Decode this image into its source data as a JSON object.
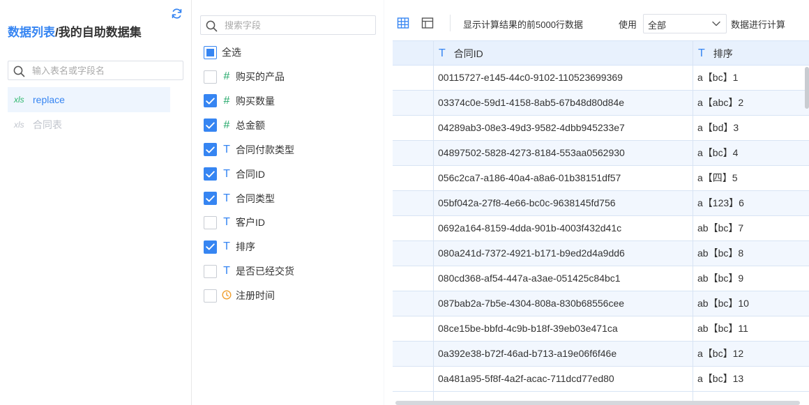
{
  "left": {
    "crumb_link": "数据列表",
    "crumb_sep": "/",
    "crumb_current": "我的自助数据集",
    "search_placeholder": "输入表名或字段名",
    "tables": [
      {
        "icon": "xls",
        "name": "replace",
        "state": "active"
      },
      {
        "icon": "xls",
        "name": "合同表",
        "state": "disabled"
      }
    ]
  },
  "middle": {
    "search_placeholder": "搜索字段",
    "select_all": {
      "label": "全选",
      "state": "partial"
    },
    "fields": [
      {
        "type": "#",
        "type_icon": "number-icon",
        "name": "购买的产品",
        "checked": false
      },
      {
        "type": "#",
        "type_icon": "number-icon",
        "name": "购买数量",
        "checked": true
      },
      {
        "type": "#",
        "type_icon": "number-icon",
        "name": "总金额",
        "checked": true
      },
      {
        "type": "T",
        "type_icon": "text-type-icon",
        "name": "合同付款类型",
        "checked": true
      },
      {
        "type": "T",
        "type_icon": "text-type-icon",
        "name": "合同ID",
        "checked": true
      },
      {
        "type": "T",
        "type_icon": "text-type-icon",
        "name": "合同类型",
        "checked": true
      },
      {
        "type": "T",
        "type_icon": "text-type-icon",
        "name": "客户ID",
        "checked": false
      },
      {
        "type": "T",
        "type_icon": "text-type-icon",
        "name": "排序",
        "checked": true
      },
      {
        "type": "T",
        "type_icon": "text-type-icon",
        "name": "是否已经交货",
        "checked": false
      },
      {
        "type": "clock",
        "type_icon": "clock-icon",
        "name": "注册时间",
        "checked": false
      }
    ]
  },
  "toolbar": {
    "desc": "显示计算结果的前5000行数据",
    "use_label": "使用",
    "select_value": "全部",
    "after_label": "数据进行计算"
  },
  "grid": {
    "columns": [
      {
        "type": "T",
        "label": "合同ID"
      },
      {
        "type": "T",
        "label": "排序"
      }
    ],
    "rows": [
      [
        "00115727-e145-44c0-9102-110523699369",
        "a【bc】1"
      ],
      [
        "03374c0e-59d1-4158-8ab5-67b48d80d84e",
        "a【abc】2"
      ],
      [
        "04289ab3-08e3-49d3-9582-4dbb945233e7",
        "a【bd】3"
      ],
      [
        "04897502-5828-4273-8184-553aa0562930",
        "a【bc】4"
      ],
      [
        "056c2ca7-a186-40a4-a8a6-01b38151df57",
        "a【四】5"
      ],
      [
        "05bf042a-27f8-4e66-bc0c-9638145fd756",
        "a【123】6"
      ],
      [
        "0692a164-8159-4dda-901b-4003f432d41c",
        "ab【bc】7"
      ],
      [
        "080a241d-7372-4921-b171-b9ed2d4a9dd6",
        "ab【bc】8"
      ],
      [
        "080cd368-af54-447a-a3ae-051425c84bc1",
        "ab【bc】9"
      ],
      [
        "087bab2a-7b5e-4304-808a-830b68556cee",
        "ab【bc】10"
      ],
      [
        "08ce15be-bbfd-4c9b-b18f-39eb03e471ca",
        "ab【bc】11"
      ],
      [
        "0a392e38-b72f-46ad-b713-a19e06f6f46e",
        "a【bc】12"
      ],
      [
        "0a481a95-5f8f-4a2f-acac-711dcd77ed80",
        "a【bc】13"
      ]
    ]
  },
  "colors": {
    "accent": "#3685f2",
    "number_type": "#26a96b",
    "time_type": "#f0a030",
    "header_bg": "#e8f1fd",
    "alt_row": "#f2f7fe"
  }
}
